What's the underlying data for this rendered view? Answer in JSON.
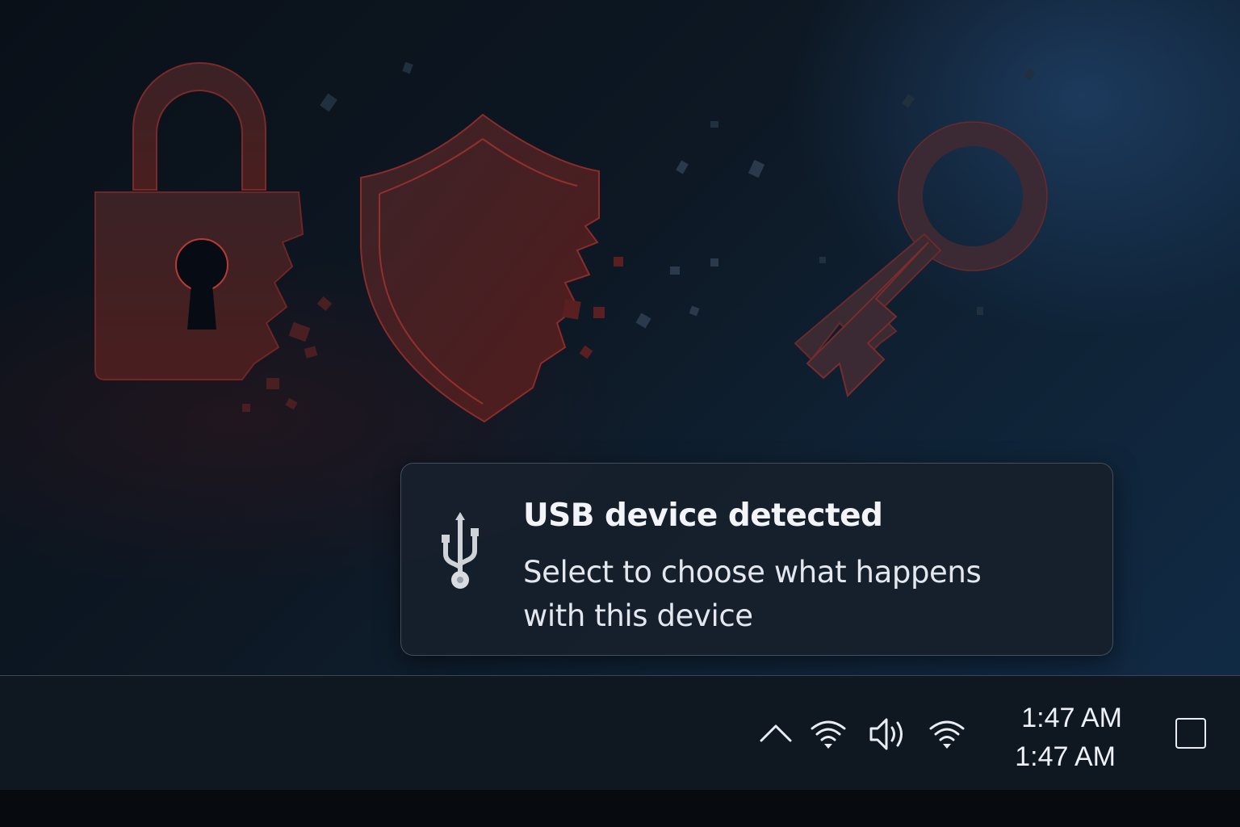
{
  "toast": {
    "icon": "usb-icon",
    "title": "USB device detected",
    "body": "Select to choose what happens with this device"
  },
  "wallpaper": {
    "icons": [
      "padlock-icon",
      "shield-icon",
      "key-icon"
    ],
    "accent": "#a3302f"
  },
  "tray": {
    "icons": [
      "chevron-up-icon",
      "wifi-icon",
      "speaker-icon",
      "wifi-icon"
    ],
    "clock_time": "1:47 AM",
    "clock_date": "1:47 AM"
  },
  "colors": {
    "background": "#0b1420",
    "taskbar": "#0f1720",
    "toast": "#16202c",
    "text": "#f2f4f7"
  }
}
